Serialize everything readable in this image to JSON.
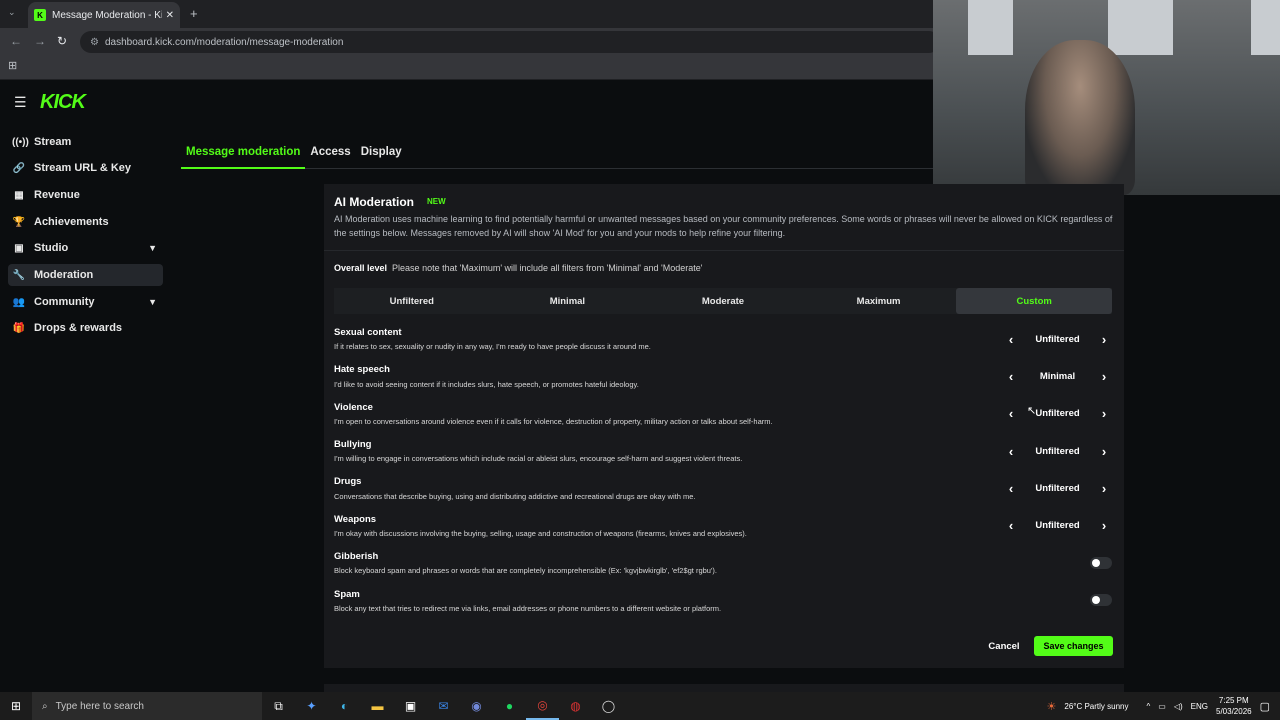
{
  "browser": {
    "tab_title": "Message Moderation - Kick Da",
    "url": "dashboard.kick.com/moderation/message-moderation"
  },
  "sidebar": {
    "logo": "KICK",
    "items": [
      {
        "label": "Stream",
        "icon": "broadcast-icon"
      },
      {
        "label": "Stream URL & Key",
        "icon": "link-icon"
      },
      {
        "label": "Revenue",
        "icon": "chart-icon"
      },
      {
        "label": "Achievements",
        "icon": "trophy-icon"
      },
      {
        "label": "Studio",
        "icon": "studio-icon",
        "expandable": true
      },
      {
        "label": "Moderation",
        "icon": "wrench-icon",
        "active": true
      },
      {
        "label": "Community",
        "icon": "community-icon",
        "expandable": true
      },
      {
        "label": "Drops & rewards",
        "icon": "gift-icon"
      }
    ]
  },
  "page_tabs": [
    "Message moderation",
    "Access",
    "Display"
  ],
  "ai_moderation": {
    "title": "AI Moderation",
    "badge": "NEW",
    "description": "AI Moderation uses machine learning to find potentially harmful or unwanted messages based on your community preferences. Some words or phrases will never be allowed on KICK regardless of the settings below. Messages removed by AI will show 'AI Mod' for you and your mods to help refine your filtering.",
    "overall_label": "Overall level",
    "overall_note": "Please note that 'Maximum' will include all filters from 'Minimal' and 'Moderate'",
    "levels": [
      "Unfiltered",
      "Minimal",
      "Moderate",
      "Maximum",
      "Custom"
    ],
    "selected_level": "Custom",
    "categories": [
      {
        "name": "Sexual content",
        "desc": "If it relates to sex, sexuality or nudity in any way, I'm ready to have people discuss it around me.",
        "value": "Unfiltered"
      },
      {
        "name": "Hate speech",
        "desc": "I'd like to avoid seeing content if it includes slurs, hate speech, or promotes hateful ideology.",
        "value": "Minimal"
      },
      {
        "name": "Violence",
        "desc": "I'm open to conversations around violence even if it calls for violence, destruction of property, military action or talks about self-harm.",
        "value": "Unfiltered"
      },
      {
        "name": "Bullying",
        "desc": "I'm willing to engage in conversations which include racial or ableist slurs, encourage self-harm and suggest violent threats.",
        "value": "Unfiltered"
      },
      {
        "name": "Drugs",
        "desc": "Conversations that describe buying, using and distributing addictive and recreational drugs are okay with me.",
        "value": "Unfiltered"
      },
      {
        "name": "Weapons",
        "desc": "I'm okay with discussions involving the buying, selling, usage and construction of weapons (firearms, knives and explosives).",
        "value": "Unfiltered"
      }
    ],
    "toggles": [
      {
        "name": "Gibberish",
        "desc": "Block keyboard spam and phrases or words that are completely incomprehensible (Ex: 'kgvjbwkirglb', 'ef2$gt rgbu').",
        "on": false
      },
      {
        "name": "Spam",
        "desc": "Block any text that tries to redirect me via links, email addresses or phone numbers to a different website or platform.",
        "on": false
      }
    ],
    "cancel_label": "Cancel",
    "save_label": "Save changes"
  },
  "taskbar": {
    "search_placeholder": "Type here to search",
    "weather": "26°C  Partly sunny",
    "language": "ENG",
    "time": "7:25 PM",
    "date": "5/03/2026"
  },
  "colors": {
    "accent": "#53fc18",
    "panel": "#18191c",
    "background": "#0b0d0f"
  }
}
